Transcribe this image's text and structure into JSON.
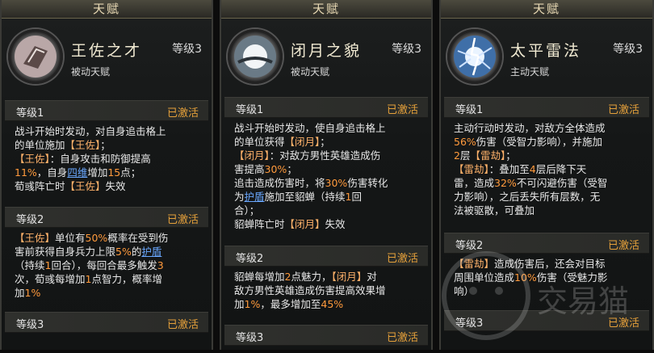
{
  "panels": [
    {
      "title": "天赋",
      "name": "王佐之才",
      "level": "等级3",
      "type": "被动天赋",
      "icon": "scroll-icon",
      "levels": [
        {
          "label": "等级1",
          "status": "已激活",
          "lines": [
            "战斗开始时发动，对自身追击格上",
            "的单位施加【王佐】；",
            "【王佐】：自身攻击和防御提高",
            "11%，自身四维增加15点；",
            "荀彧阵亡时【王佐】失效"
          ]
        },
        {
          "label": "等级2",
          "status": "已激活",
          "lines": [
            "【王佐】单位有50%概率在受到伤",
            "害前获得自身兵力上限5%的护盾",
            "（持续1回合），每回合最多触发3",
            "次，荀彧每增加1点智力，概率增",
            "加1%"
          ]
        },
        {
          "label": "等级3",
          "status": "已激活",
          "lines": []
        }
      ]
    },
    {
      "title": "天赋",
      "name": "闭月之貌",
      "level": "等级3",
      "type": "被动天赋",
      "icon": "moon-icon",
      "levels": [
        {
          "label": "等级1",
          "status": "已激活",
          "lines": [
            "战斗开始时发动，使自身追击格上",
            "的单位获得【闭月】；",
            "【闭月】：对敌方男性英雄造成伤",
            "害提高30%；",
            "追击造成伤害时，将30%伤害转化",
            "为护盾施加至貂蝉（持续1回",
            "合）；",
            "貂蝉阵亡时【闭月】失效"
          ]
        },
        {
          "label": "等级2",
          "status": "已激活",
          "lines": [
            "貂蝉每增加2点魅力，【闭月】对",
            "敌方男性英雄造成伤害提高效果增",
            "加1%，最多增加至45%"
          ]
        },
        {
          "label": "等级3",
          "status": "已激活",
          "lines": []
        }
      ]
    },
    {
      "title": "天赋",
      "name": "太平雷法",
      "level": "等级3",
      "type": "主动天赋",
      "icon": "lightning-icon",
      "levels": [
        {
          "label": "等级1",
          "status": "已激活",
          "lines": [
            "主动行动时发动，对敌方全体造成",
            "56%伤害（受智力影响），并施加",
            "2层【雷劫】；",
            "【雷劫】：叠加至4层后降下天",
            "雷，造成32%不可闪避伤害（受智",
            "力影响），之后丢失所有层数，无",
            "法被驱散，可叠加"
          ]
        },
        {
          "label": "等级2",
          "status": "已激活",
          "lines": [
            "【雷劫】造成伤害后，还会对目标",
            "周围单位造成10%伤害（受魅力影",
            "响）"
          ]
        },
        {
          "label": "等级3",
          "status": "已激活",
          "lines": []
        }
      ]
    }
  ],
  "watermark": "交易猫"
}
